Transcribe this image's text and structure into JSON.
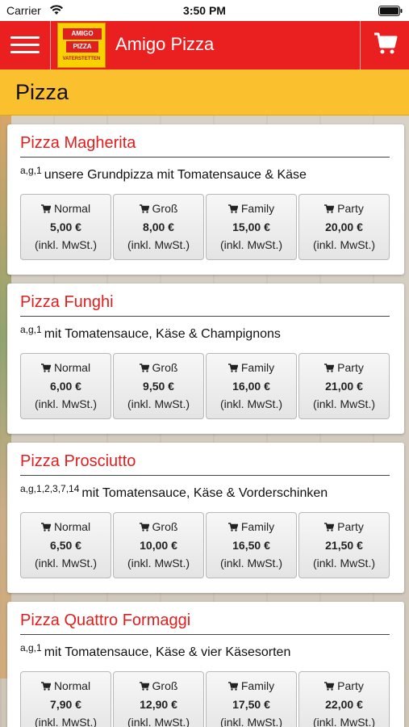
{
  "status_bar": {
    "carrier": "Carrier",
    "time": "3:50 PM"
  },
  "navbar": {
    "title": "Amigo Pizza",
    "logo_text": {
      "line1": "AMIGO",
      "line2": "PIZZA",
      "line3": "VATERSTETTEN"
    }
  },
  "section": {
    "title": "Pizza"
  },
  "products": [
    {
      "name": "Pizza Magherita",
      "codes": "a,g,1",
      "description": "unsere Grundpizza mit Tomatensauce & Käse",
      "prices": [
        {
          "size": "Normal",
          "price": "5,00 €",
          "tax": "(inkl. MwSt.)"
        },
        {
          "size": "Groß",
          "price": "8,00 €",
          "tax": "(inkl. MwSt.)"
        },
        {
          "size": "Family",
          "price": "15,00 €",
          "tax": "(inkl. MwSt.)"
        },
        {
          "size": "Party",
          "price": "20,00 €",
          "tax": "(inkl. MwSt.)"
        }
      ]
    },
    {
      "name": "Pizza Funghi",
      "codes": "a,g,1",
      "description": "mit Tomatensauce, Käse & Champignons",
      "prices": [
        {
          "size": "Normal",
          "price": "6,00 €",
          "tax": "(inkl. MwSt.)"
        },
        {
          "size": "Groß",
          "price": "9,50 €",
          "tax": "(inkl. MwSt.)"
        },
        {
          "size": "Family",
          "price": "16,00 €",
          "tax": "(inkl. MwSt.)"
        },
        {
          "size": "Party",
          "price": "21,00 €",
          "tax": "(inkl. MwSt.)"
        }
      ]
    },
    {
      "name": "Pizza Prosciutto",
      "codes": "a,g,1,2,3,7,14",
      "description": "mit Tomatensauce, Käse & Vorderschinken",
      "prices": [
        {
          "size": "Normal",
          "price": "6,50 €",
          "tax": "(inkl. MwSt.)"
        },
        {
          "size": "Groß",
          "price": "10,00 €",
          "tax": "(inkl. MwSt.)"
        },
        {
          "size": "Family",
          "price": "16,50 €",
          "tax": "(inkl. MwSt.)"
        },
        {
          "size": "Party",
          "price": "21,50 €",
          "tax": "(inkl. MwSt.)"
        }
      ]
    },
    {
      "name": "Pizza Quattro Formaggi",
      "codes": "a,g,1",
      "description": "mit Tomatensauce, Käse & vier Käsesorten",
      "prices": [
        {
          "size": "Normal",
          "price": "7,90 €",
          "tax": "(inkl. MwSt.)"
        },
        {
          "size": "Groß",
          "price": "12,90 €",
          "tax": "(inkl. MwSt.)"
        },
        {
          "size": "Family",
          "price": "17,50 €",
          "tax": "(inkl. MwSt.)"
        },
        {
          "size": "Party",
          "price": "22,00 €",
          "tax": "(inkl. MwSt.)"
        }
      ]
    }
  ],
  "icons": {
    "menu": "hamburger-menu-icon",
    "cart": "shopping-cart-icon",
    "wifi": "wifi-icon",
    "battery": "battery-icon"
  },
  "colors": {
    "navbar": "#ea1f1f",
    "section_header": "#fbc02d",
    "product_title": "#e31d1d"
  }
}
